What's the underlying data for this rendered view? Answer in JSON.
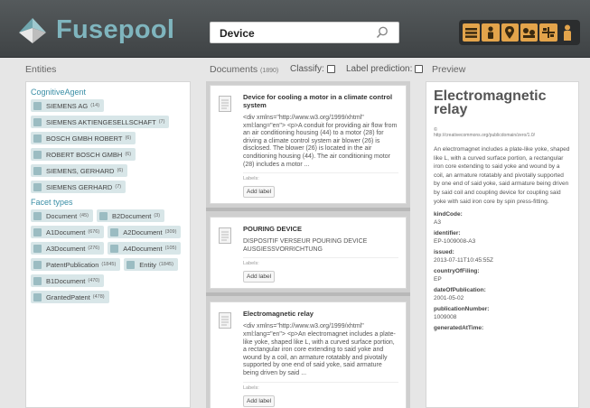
{
  "app": {
    "name": "Fusepool",
    "brand_color": "#7fb5be",
    "accent_color": "#e3a44b"
  },
  "search": {
    "value": "Device"
  },
  "toolbar": {
    "icons": [
      "list-icon",
      "person-icon",
      "map-pin-icon",
      "chart-icon",
      "grid-icon",
      "user-icon"
    ]
  },
  "entities": {
    "title": "Entities",
    "sections": [
      {
        "title": "CognitiveAgent",
        "tags": [
          {
            "label": "SIEMENS AG",
            "count": "(14)"
          },
          {
            "label": "SIEMENS AKTIENGESELLSCHAFT",
            "count": "(7)"
          },
          {
            "label": "BOSCH GMBH ROBERT",
            "count": "(6)"
          },
          {
            "label": "ROBERT BOSCH GMBH",
            "count": "(6)"
          },
          {
            "label": "SIEMENS, GERHARD",
            "count": "(6)"
          },
          {
            "label": "SIEMENS GERHARD",
            "count": "(7)"
          }
        ]
      },
      {
        "title": "Facet types",
        "tags": [
          {
            "label": "Document",
            "count": "(45)"
          },
          {
            "label": "B2Document",
            "count": "(3)"
          },
          {
            "label": "A1Document",
            "count": "(676)"
          },
          {
            "label": "A2Document",
            "count": "(309)"
          },
          {
            "label": "A3Document",
            "count": "(276)"
          },
          {
            "label": "A4Document",
            "count": "(105)"
          },
          {
            "label": "PatentPublication",
            "count": "(1845)"
          },
          {
            "label": "Entity",
            "count": "(1845)"
          },
          {
            "label": "B1Document",
            "count": "(470)"
          },
          {
            "label": "GrantedPatent",
            "count": "(478)"
          }
        ]
      }
    ]
  },
  "documents": {
    "title": "Documents",
    "count": "(1890)",
    "classify_label": "Classify:",
    "label_prediction": "Label prediction:",
    "labels_caption": "Labels:",
    "add_label": "Add label",
    "items": [
      {
        "title": "Device for cooling a motor in a climate control system",
        "body": "<div xmlns=\"http://www.w3.org/1999/xhtml\" xml:lang=\"en\"> <p>A conduit for providing air flow from an air conditioning housing (44) to a motor (28) for driving a climate control system air blower (26) is disclosed. The blower (26) is located in the air conditioning housing (44). The air conditioning motor (28) includes a motor ..."
      },
      {
        "title": "POURING DEVICE",
        "body": "DISPOSITIF VERSEUR POURING DEVICE AUSGIESSVORRICHTUNG"
      },
      {
        "title": "Electromagnetic relay",
        "body": "<div xmlns=\"http://www.w3.org/1999/xhtml\" xml:lang=\"en\"> <p>An electromagnet includes a plate-like yoke, shaped like L, with a curved surface portion, a rectangular iron core extending to said yoke and wound by a coil, an armature rotatably and pivotally supported by one end of said yoke, said armature being driven by said ..."
      }
    ]
  },
  "preview": {
    "title": "Preview",
    "doc_title": "Electromagnetic relay",
    "copyright": "©",
    "license_url": "http://creativecommons.org/publicdomain/zero/1.0/",
    "description": "An electromagnet includes a plate-like yoke, shaped like L, with a curved surface portion, a rectangular iron core extending to said yoke and wound by a coil, an armature rotatably and pivotally supported by one end of said yoke, said armature being driven by said coil and coupling device for coupling said yoke with said iron core by spin press-fitting.",
    "fields": [
      {
        "key": "kindCode:",
        "value": "A3"
      },
      {
        "key": "identifier:",
        "value": "EP-1009008-A3"
      },
      {
        "key": "issued:",
        "value": "2013-07-11T10:45:55Z"
      },
      {
        "key": "countryOfFiling:",
        "value": "EP"
      },
      {
        "key": "dateOfPublication:",
        "value": "2001-05-02"
      },
      {
        "key": "publicationNumber:",
        "value": "1009008"
      },
      {
        "key": "generatedAtTime:",
        "value": ""
      }
    ]
  }
}
